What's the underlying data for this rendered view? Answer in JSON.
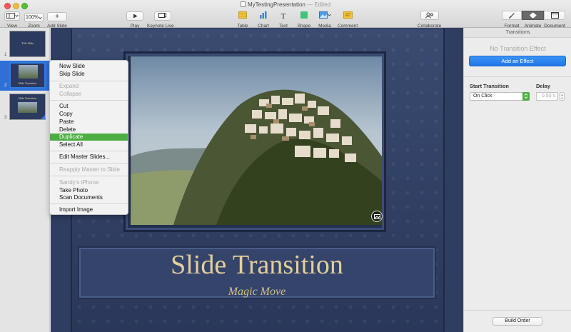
{
  "window": {
    "title": "MyTestingPresentation",
    "status": "— Edited"
  },
  "toolbar": {
    "view_label": "View",
    "zoom_value": "100%",
    "zoom_label": "Zoom",
    "add_slide_label": "Add Slide",
    "play_label": "Play",
    "keynote_live_label": "Keynote Live",
    "table_label": "Table",
    "chart_label": "Chart",
    "text_label": "Text",
    "shape_label": "Shape",
    "media_label": "Media",
    "comment_label": "Comment",
    "collaborate_label": "Collaborate",
    "format_label": "Format",
    "animate_label": "Animate",
    "document_label": "Document"
  },
  "navigator": {
    "slides": [
      {
        "number": "1",
        "title": "Title Slide"
      },
      {
        "number": "2",
        "title": "Slide Transition"
      },
      {
        "number": "3",
        "title": "Slide Transition"
      }
    ]
  },
  "context_menu": {
    "items": [
      {
        "label": "New Slide",
        "enabled": true
      },
      {
        "label": "Skip Slide",
        "enabled": true
      },
      {
        "label": "Expand",
        "enabled": false
      },
      {
        "label": "Collapse",
        "enabled": false
      },
      {
        "label": "Cut",
        "enabled": true
      },
      {
        "label": "Copy",
        "enabled": true
      },
      {
        "label": "Paste",
        "enabled": true
      },
      {
        "label": "Delete",
        "enabled": true
      },
      {
        "label": "Duplicate",
        "enabled": true,
        "highlighted": true
      },
      {
        "label": "Select All",
        "enabled": true
      },
      {
        "label": "Edit Master Slides...",
        "enabled": true
      },
      {
        "label": "Reapply Master to Slide",
        "enabled": false
      },
      {
        "label": "Sandy's iPhone",
        "enabled": false
      },
      {
        "label": "Take Photo",
        "enabled": true
      },
      {
        "label": "Scan Documents",
        "enabled": true
      },
      {
        "label": "Import Image",
        "enabled": true
      }
    ]
  },
  "slide": {
    "title": "Slide Transition",
    "subtitle": "Magic Move"
  },
  "inspector": {
    "header": "Transitions",
    "no_effect": "No Transition Effect",
    "add_effect": "Add an Effect",
    "start_transition_label": "Start Transition",
    "start_transition_value": "On Click",
    "delay_label": "Delay",
    "delay_value": "0.50 s",
    "build_order": "Build Order"
  },
  "colors": {
    "accent_blue": "#2f7ee2",
    "menu_highlight": "#4cae42",
    "slide_bg": "#2f3d60",
    "title_gold": "#e4cf9b"
  }
}
